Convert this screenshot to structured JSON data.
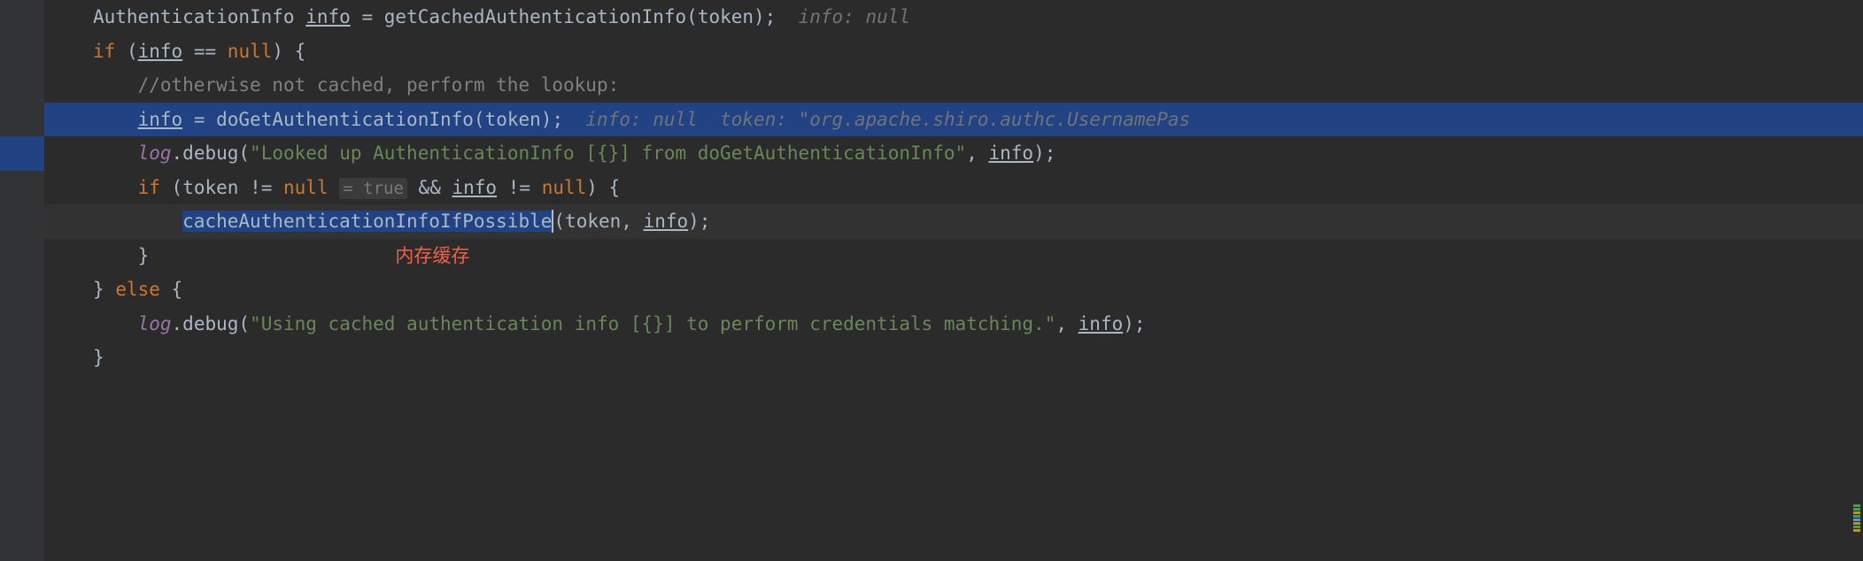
{
  "lines": {
    "l1": {
      "type": "AuthenticationInfo",
      "var": "info",
      "method": "getCachedAuthenticationInfo",
      "param": "token",
      "hint": "info: null"
    },
    "l2": {
      "keyword_if": "if",
      "var": "info",
      "op": "==",
      "null": "null"
    },
    "l3": {
      "comment": "//otherwise not cached, perform the lookup:"
    },
    "l4": {
      "var": "info",
      "method": "doGetAuthenticationInfo",
      "param": "token",
      "hint_info": "info: null",
      "hint_token": "token: \"org.apache.shiro.authc.UsernamePas"
    },
    "l5": {
      "field": "log",
      "method": "debug",
      "string": "\"Looked up AuthenticationInfo [{}] from doGetAuthenticationInfo\"",
      "var": "info"
    },
    "l6": {
      "keyword_if": "if",
      "var_token": "token",
      "op_ne": "!=",
      "null1": "null",
      "inlay": "= true",
      "op_and": "&&",
      "var_info": "info",
      "null2": "null"
    },
    "l7": {
      "method": "cacheAuthenticationInfoIfPossible",
      "param1": "token",
      "param2": "info"
    },
    "l8": {
      "brace": "}",
      "annotation": "内存缓存"
    },
    "l9": {
      "brace": "}",
      "keyword_else": "else"
    },
    "l10": {
      "field": "log",
      "method": "debug",
      "string": "\"Using cached authentication info [{}] to perform credentials matching.\"",
      "var": "info"
    },
    "l11": {
      "brace": "}"
    }
  }
}
